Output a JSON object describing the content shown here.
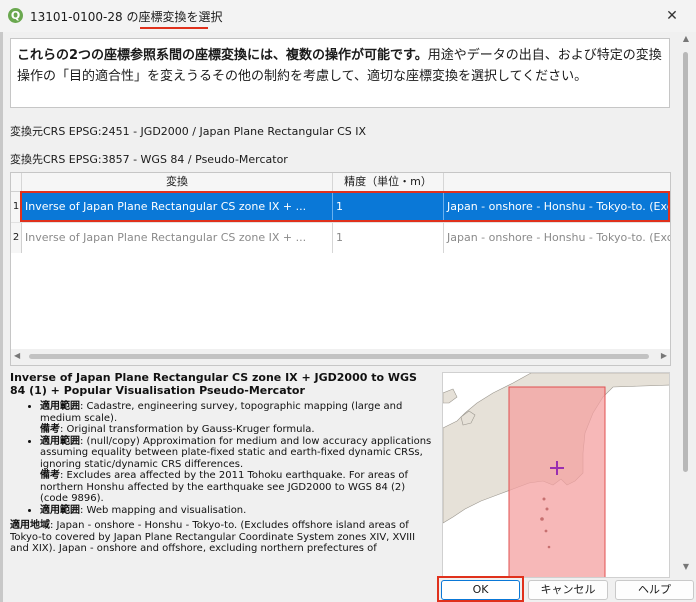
{
  "window": {
    "title_prefix": "13101-0100-28 の",
    "title_highlight": "座標変換を選択",
    "close_glyph": "✕"
  },
  "description": {
    "bold": "これらの2つの座標参照系間の座標変換には、複数の操作が可能です。",
    "rest": "用途やデータの出自、および特定の変換操作の「目的適合性」を変えうるその他の制約を考慮して、適切な座標変換を選択してください。"
  },
  "crs": {
    "source": "変換元CRS EPSG:2451 - JGD2000 / Japan Plane Rectangular CS IX",
    "destination": "変換先CRS EPSG:3857 - WGS 84 / Pseudo-Mercator"
  },
  "table": {
    "headers": [
      "変換",
      "精度（単位・m）",
      ""
    ],
    "rows": [
      {
        "num": "1",
        "name": "Inverse of Japan Plane Rectangular CS zone IX + ...",
        "accuracy": "1",
        "area": "Japan - onshore - Honshu - Tokyo-to. (Exclu"
      },
      {
        "num": "2",
        "name": "Inverse of Japan Plane Rectangular CS zone IX + ...",
        "accuracy": "1",
        "area": "Japan - onshore - Honshu - Tokyo-to. (Exclu"
      }
    ]
  },
  "details": {
    "title": "Inverse of Japan Plane Rectangular CS zone IX + JGD2000 to WGS 84 (1) + Popular Visualisation Pseudo-Mercator",
    "scope_label": "適用範囲",
    "remarks_label": "備考",
    "items": [
      {
        "scope": ": Cadastre, engineering survey, topographic mapping (large and medium scale).",
        "remarks": ": Original transformation by Gauss-Kruger formula."
      },
      {
        "scope": ": (null/copy) Approximation for medium and low accuracy applications assuming equality between plate-fixed static and earth-fixed dynamic CRSs, ignoring static/dynamic CRS differences.",
        "remarks": ": Excludes area affected by the 2011 Tohoku earthquake. For areas of northern Honshu affected by the earthquake see JGD2000 to WGS 84 (2) (code 9896)."
      },
      {
        "scope": ": Web mapping and visualisation.",
        "remarks": ""
      }
    ],
    "area_label": "適用地域",
    "area_text": ": Japan - onshore - Honshu - Tokyo-to. (Excludes offshore island areas of Tokyo-to covered by Japan Plane Rectangular Coordinate System zones XIV, XVIII and XIX). Japan - onshore and offshore, excluding northern prefectures of"
  },
  "map": {
    "land_color": "#e6e1d8",
    "bbox_fill": "#f4a0a0",
    "bbox_stroke": "#e05050",
    "marker_color": "#9a2fb0"
  },
  "buttons": {
    "ok": "OK",
    "cancel": "キャンセル",
    "help": "ヘルプ"
  }
}
